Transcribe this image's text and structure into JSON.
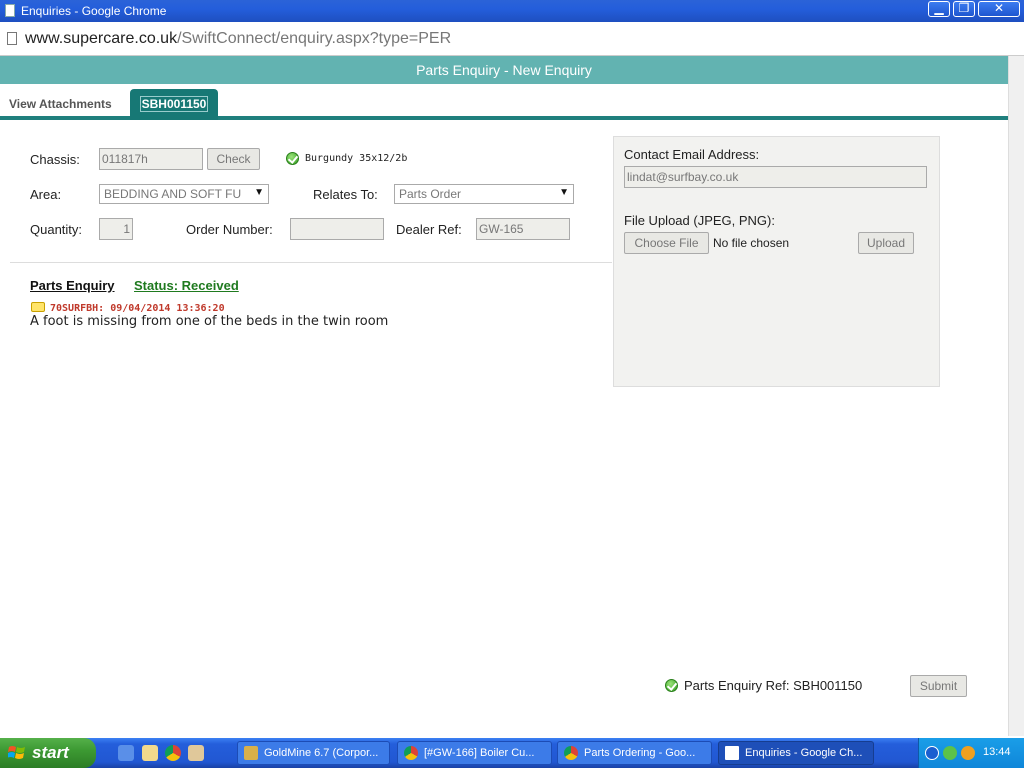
{
  "window": {
    "title": "Enquiries - Google Chrome",
    "min_glyph": "▁",
    "max_glyph": "❐",
    "close_glyph": "✕"
  },
  "address": {
    "host": "www.supercare.co.uk",
    "path": "/SwiftConnect/enquiry.aspx?type=PER"
  },
  "page": {
    "header": "Parts Enquiry - New Enquiry"
  },
  "tabs": [
    {
      "label": "View Attachments"
    },
    {
      "label": "SBH001150"
    }
  ],
  "form": {
    "chassis_label": "Chassis:",
    "chassis_value": "011817h",
    "check_button": "Check",
    "model_text": "Burgundy 35x12/2b",
    "area_label": "Area:",
    "area_value": "BEDDING AND SOFT FU",
    "relates_label": "Relates To:",
    "relates_value": "Parts Order",
    "quantity_label": "Quantity:",
    "quantity_value": "1",
    "order_label": "Order Number:",
    "order_value": "",
    "dealer_label": "Dealer Ref:",
    "dealer_value": "GW-165"
  },
  "enquiry": {
    "section_title": "Parts Enquiry",
    "status": "Status: Received",
    "comment_meta": "70SURFBH: 09/04/2014 13:36:20",
    "comment_text": "A foot is missing from one of the beds in the twin room"
  },
  "contact": {
    "email_label": "Contact Email Address:",
    "email_value": "lindat@surfbay.co.uk",
    "upload_label": "File Upload (JPEG, PNG):",
    "choose_button": "Choose File",
    "no_file": "No file chosen",
    "upload_button": "Upload"
  },
  "footer": {
    "ref_text": "Parts Enquiry Ref: SBH001150",
    "submit_button": "Submit"
  },
  "taskbar": {
    "start_label": "start",
    "tasks": [
      {
        "label": "GoldMine 6.7 (Corpor..."
      },
      {
        "label": "[#GW-166] Boiler Cu..."
      },
      {
        "label": "Parts Ordering - Goo..."
      },
      {
        "label": "Enquiries - Google Ch..."
      }
    ],
    "clock": "13:44"
  }
}
